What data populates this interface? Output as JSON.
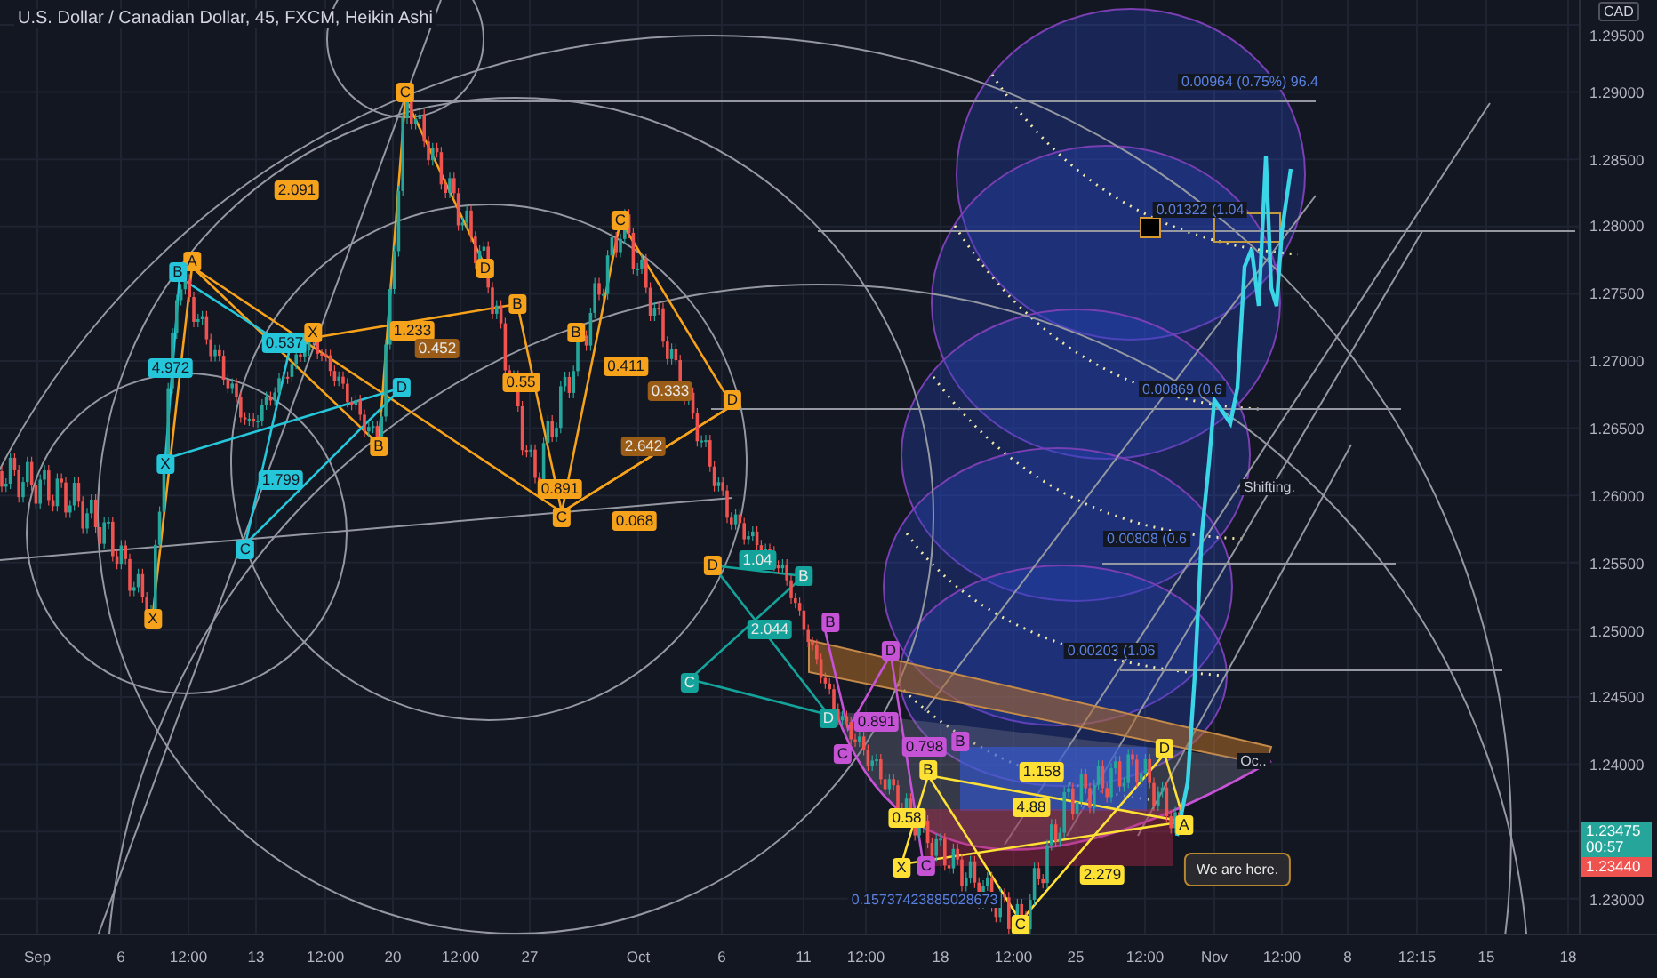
{
  "chart": {
    "title": "U.S. Dollar / Canadian Dollar, 45, FXCM, Heikin Ashi",
    "pattern_labels": [
      {
        "text": "C",
        "color": "#f7a21b"
      },
      {
        "text": "2.091",
        "color": "#f7a21b"
      },
      {
        "text": "A",
        "color": "#f7a21b"
      },
      {
        "text": "B",
        "color": "#26c6da"
      },
      {
        "text": "4.972",
        "color": "#26c6da"
      },
      {
        "text": "0.537",
        "color": "#26c6da"
      },
      {
        "text": "X",
        "color": "#f7a21b"
      },
      {
        "text": "1.233",
        "color": "#f7a21b"
      },
      {
        "text": "0.452",
        "color": "#9a5c16"
      },
      {
        "text": "D",
        "color": "#f7a21b"
      },
      {
        "text": "B",
        "color": "#f7a21b"
      },
      {
        "text": "B",
        "color": "#f7a21b"
      },
      {
        "text": "C",
        "color": "#f7a21b"
      },
      {
        "text": "0.411",
        "color": "#f7a21b"
      },
      {
        "text": "0.55",
        "color": "#f7a21b"
      },
      {
        "text": "D",
        "color": "#26c6da"
      },
      {
        "text": "0.333",
        "color": "#9a5c16"
      },
      {
        "text": "D",
        "color": "#f7a21b"
      },
      {
        "text": "1.799",
        "color": "#26c6da"
      },
      {
        "text": "B",
        "color": "#f7a21b"
      },
      {
        "text": "X",
        "color": "#26c6da"
      },
      {
        "text": "2.642",
        "color": "#9a5c16"
      },
      {
        "text": "0.891",
        "color": "#f7a21b"
      },
      {
        "text": "C",
        "color": "#f7a21b"
      },
      {
        "text": "0.068",
        "color": "#f7a21b"
      },
      {
        "text": "C",
        "color": "#26c6da"
      },
      {
        "text": "X",
        "color": "#f7a21b"
      },
      {
        "text": "D",
        "color": "#f7a21b"
      },
      {
        "text": "1.04",
        "color": "#14a39a"
      },
      {
        "text": "B",
        "color": "#14a39a"
      },
      {
        "text": "2.044",
        "color": "#14a39a"
      },
      {
        "text": "C",
        "color": "#14a39a"
      },
      {
        "text": "D",
        "color": "#14a39a"
      },
      {
        "text": "B",
        "color": "#c653d6"
      },
      {
        "text": "D",
        "color": "#c653d6"
      },
      {
        "text": "C",
        "color": "#c653d6"
      },
      {
        "text": "0.891",
        "color": "#c653d6"
      },
      {
        "text": "0.798",
        "color": "#c653d6"
      },
      {
        "text": "B",
        "color": "#c653d6"
      },
      {
        "text": "B",
        "color": "#ffe135"
      },
      {
        "text": "1.158",
        "color": "#ffe135"
      },
      {
        "text": "D",
        "color": "#ffe135"
      },
      {
        "text": "4.88",
        "color": "#ffe135"
      },
      {
        "text": "0.58",
        "color": "#ffe135"
      },
      {
        "text": "X",
        "color": "#ffe135"
      },
      {
        "text": "C",
        "color": "#c653d6"
      },
      {
        "text": "A",
        "color": "#ffe135"
      },
      {
        "text": "2.279",
        "color": "#ffe135"
      },
      {
        "text": "C",
        "color": "#ffe135"
      }
    ],
    "annotations": [
      {
        "text": "0.00964 (0.75%) 96.4",
        "kind": "measure"
      },
      {
        "text": "0.01322 (1.04",
        "kind": "measure"
      },
      {
        "text": "0.00869 (0.6",
        "kind": "measure"
      },
      {
        "text": "Shifting.",
        "kind": "note"
      },
      {
        "text": "0.00808 (0.6",
        "kind": "measure"
      },
      {
        "text": "0.00203 (1.06",
        "kind": "measure"
      },
      {
        "text": "Oc..",
        "kind": "note"
      },
      {
        "text": "We are here.",
        "kind": "callout"
      },
      {
        "text": "0.15737423885028673",
        "kind": "measure"
      }
    ]
  },
  "price_axis": {
    "currency": "CAD",
    "ticks": [
      "1.29500",
      "1.29000",
      "1.28500",
      "1.28000",
      "1.27500",
      "1.27000",
      "1.26500",
      "1.26000",
      "1.25500",
      "1.25000",
      "1.24500",
      "1.24000",
      "1.23000"
    ],
    "last_price": "1.23475",
    "countdown": "00:57",
    "bid_price": "1.23440"
  },
  "time_axis": {
    "ticks": [
      "Sep",
      "6",
      "12:00",
      "13",
      "12:00",
      "20",
      "12:00",
      "27",
      "Oct",
      "6",
      "11",
      "12:00",
      "18",
      "12:00",
      "25",
      "12:00",
      "Nov",
      "12:00",
      "8",
      "12:15",
      "15",
      "18"
    ]
  }
}
